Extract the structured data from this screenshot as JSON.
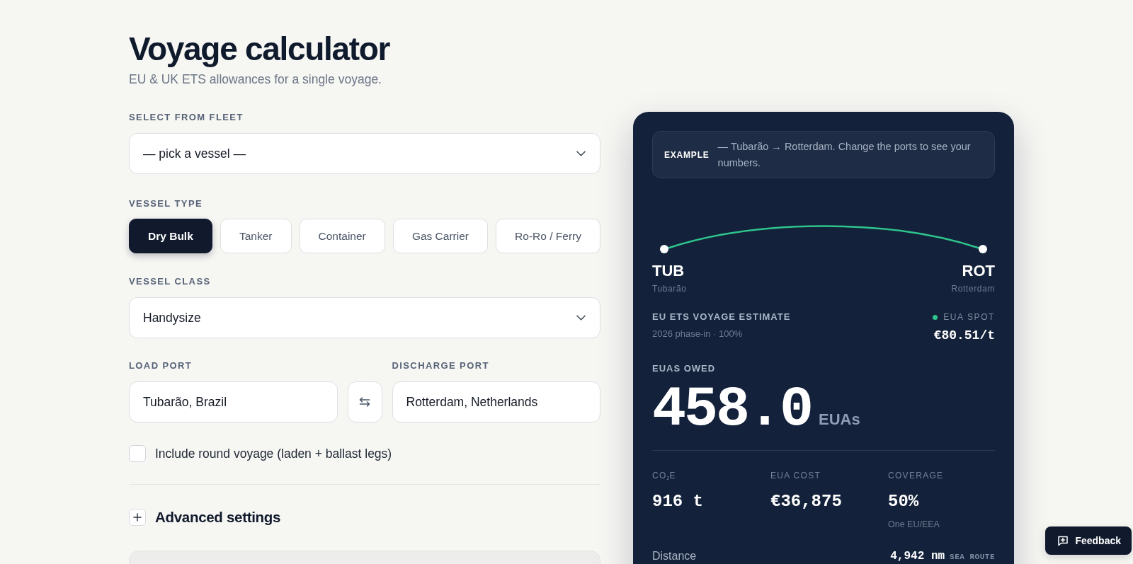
{
  "header": {
    "title": "Voyage calculator",
    "subtitle": "EU & UK ETS allowances for a single voyage."
  },
  "fleet_select": {
    "label": "SELECT FROM FLEET",
    "value": "— pick a vessel —"
  },
  "vessel_type": {
    "label": "VESSEL TYPE",
    "options": [
      {
        "label": "Dry Bulk",
        "selected": true
      },
      {
        "label": "Tanker",
        "selected": false
      },
      {
        "label": "Container",
        "selected": false
      },
      {
        "label": "Gas Carrier",
        "selected": false
      },
      {
        "label": "Ro-Ro / Ferry",
        "selected": false
      }
    ]
  },
  "vessel_class": {
    "label": "VESSEL CLASS",
    "value": "Handysize"
  },
  "ports": {
    "load": {
      "label": "LOAD PORT",
      "value": "Tubarão, Brazil"
    },
    "discharge": {
      "label": "DISCHARGE PORT",
      "value": "Rotterdam, Netherlands"
    }
  },
  "round_voyage": {
    "label": "Include round voyage (laden + ballast legs)",
    "checked": false
  },
  "advanced": {
    "label": "Advanced settings",
    "expanded": false
  },
  "estimate": {
    "banner": {
      "tag": "EXAMPLE",
      "text": "— Tubarão → Rotterdam. Change the ports to see your numbers."
    },
    "route": {
      "from": {
        "code": "TUB",
        "name": "Tubarão"
      },
      "to": {
        "code": "ROT",
        "name": "Rotterdam"
      }
    },
    "title": "EU ETS VOYAGE ESTIMATE",
    "subtitle": "2026 phase-in · 100%",
    "spot": {
      "label": "EUA SPOT",
      "value": "€80.51/t"
    },
    "owed": {
      "label": "EUAS OWED",
      "value": "458.0",
      "unit": "EUAs"
    },
    "metrics": [
      {
        "label": "CO$_{2}$E",
        "value": "916 t"
      },
      {
        "label": "EUA COST",
        "value": "€36,875"
      },
      {
        "label": "COVERAGE",
        "value": "50%",
        "note": "One EU/EEA"
      }
    ],
    "details": [
      {
        "label": "Distance",
        "value": "4,942 nm",
        "note": "SEA ROUTE"
      }
    ]
  },
  "feedback_button": {
    "label": "Feedback"
  }
}
